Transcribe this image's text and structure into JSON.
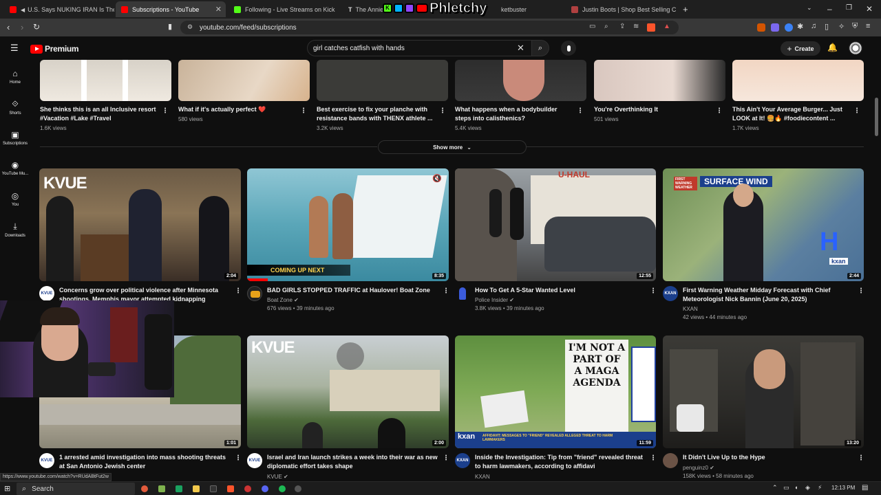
{
  "browser": {
    "tabs": [
      {
        "label": "U.S. Says NUKING IRAN Is The O",
        "favicon_color": "#ff0000"
      },
      {
        "label": "Subscriptions - YouTube",
        "favicon_color": "#ff0000",
        "active": true
      },
      {
        "label": "Following - Live Streams on Kick",
        "favicon_color": "#53fc18"
      },
      {
        "label": "The Annie",
        "favicon_color": "#e0e0e0"
      },
      {
        "label": "ketbuster",
        "favicon_color": "#888888"
      },
      {
        "label": "Justin Boots | Shop Best Selling Cowb",
        "favicon_color": "#b04040"
      }
    ],
    "overlay_logo": "Phletchy",
    "url": "youtube.com/feed/subscriptions",
    "status_url": "https://www.youtube.com/watch?v=RUdABtFut2w"
  },
  "youtube": {
    "logo_text": "Premium",
    "search_value": "girl catches catfish with hands",
    "create_label": "Create",
    "sidebar": [
      {
        "label": "Home",
        "icon": "home-icon"
      },
      {
        "label": "Shorts",
        "icon": "shorts-icon"
      },
      {
        "label": "Subscriptions",
        "icon": "subscriptions-icon"
      },
      {
        "label": "YouTube Mu...",
        "icon": "music-icon"
      },
      {
        "label": "You",
        "icon": "you-icon"
      },
      {
        "label": "Downloads",
        "icon": "download-icon"
      }
    ],
    "shorts": [
      {
        "title": "She thinks this is an all Inclusive resort #Vacation #Lake #Travel",
        "views": "1.6K views"
      },
      {
        "title": "What if it's actually perfect ❤️",
        "views": "580 views"
      },
      {
        "title": "Best exercise to fix your planche with resistance bands with THENX athlete ...",
        "views": "3.2K views"
      },
      {
        "title": "What happens when a bodybuilder steps into calisthenics?",
        "views": "5.4K views"
      },
      {
        "title": "You're Overthinking It",
        "views": "501 views"
      },
      {
        "title": "This Ain't Your Average Burger... Just LOOK at It! 🍔🔥 #foodiecontent ...",
        "views": "1.7K views"
      }
    ],
    "show_more": "Show more",
    "videos_row1": [
      {
        "title": "Concerns grow over political violence after Minnesota shootings, Memphis mayor attempted kidnapping",
        "duration": "2:04",
        "thumb_text": "KVUE",
        "channel": "",
        "meta": ""
      },
      {
        "title": "BAD GIRLS STOPPED TRAFFIC at Haulover! Boat Zone",
        "duration": "8:35",
        "thumb_text": "COMING UP NEXT",
        "channel": "Boat Zone",
        "meta": "676 views • 39 minutes ago"
      },
      {
        "title": "How To Get A 5-Star Wanted Level",
        "duration": "12:55",
        "thumb_text": "U-HAUL",
        "channel": "Police Insider",
        "meta": "3.8K views • 39 minutes ago"
      },
      {
        "title": "First Warning Weather Midday Forecast with Chief Meteorologist Nick Bannin (June 20, 2025)",
        "duration": "2:44",
        "thumb_text": "SURFACE WIND",
        "thumb_badge": "FIRST WARNING WEATHER",
        "channel": "KXAN",
        "meta": "42 views • 44 minutes ago"
      }
    ],
    "videos_row2": [
      {
        "title": "1 arrested amid investigation into mass shooting threats at San Antonio Jewish center",
        "duration": "1:01",
        "channel": "",
        "meta": ""
      },
      {
        "title": "Israel and Iran launch strikes a week into their war as new diplomatic effort takes shape",
        "duration": "2:00",
        "thumb_text": "KVUE",
        "channel": "KVUE",
        "meta": ""
      },
      {
        "title": "Inside the Investigation: Tip from \"friend\" revealed threat to harm lawmakers, according to affidavi",
        "duration": "11:59",
        "thumb_text": "I'M NOT A PART OF A MAGA AGENDA",
        "thumb_caption": "AFFIDAVIT: MESSAGES TO \"FRIEND\" REVEALED ALLEGED THREAT TO HARM LAWMAKERS",
        "channel": "KXAN",
        "meta": ""
      },
      {
        "title": "It Didn't Live Up to the Hype",
        "duration": "13:20",
        "channel": "penguinz0",
        "meta": "158K views • 58 minutes ago"
      }
    ]
  },
  "taskbar": {
    "search_label": "Search",
    "clock": "12:13 PM"
  },
  "colors": {
    "bg": "#0f0f0f",
    "accent": "#ff0000",
    "text_secondary": "#aaaaaa"
  }
}
